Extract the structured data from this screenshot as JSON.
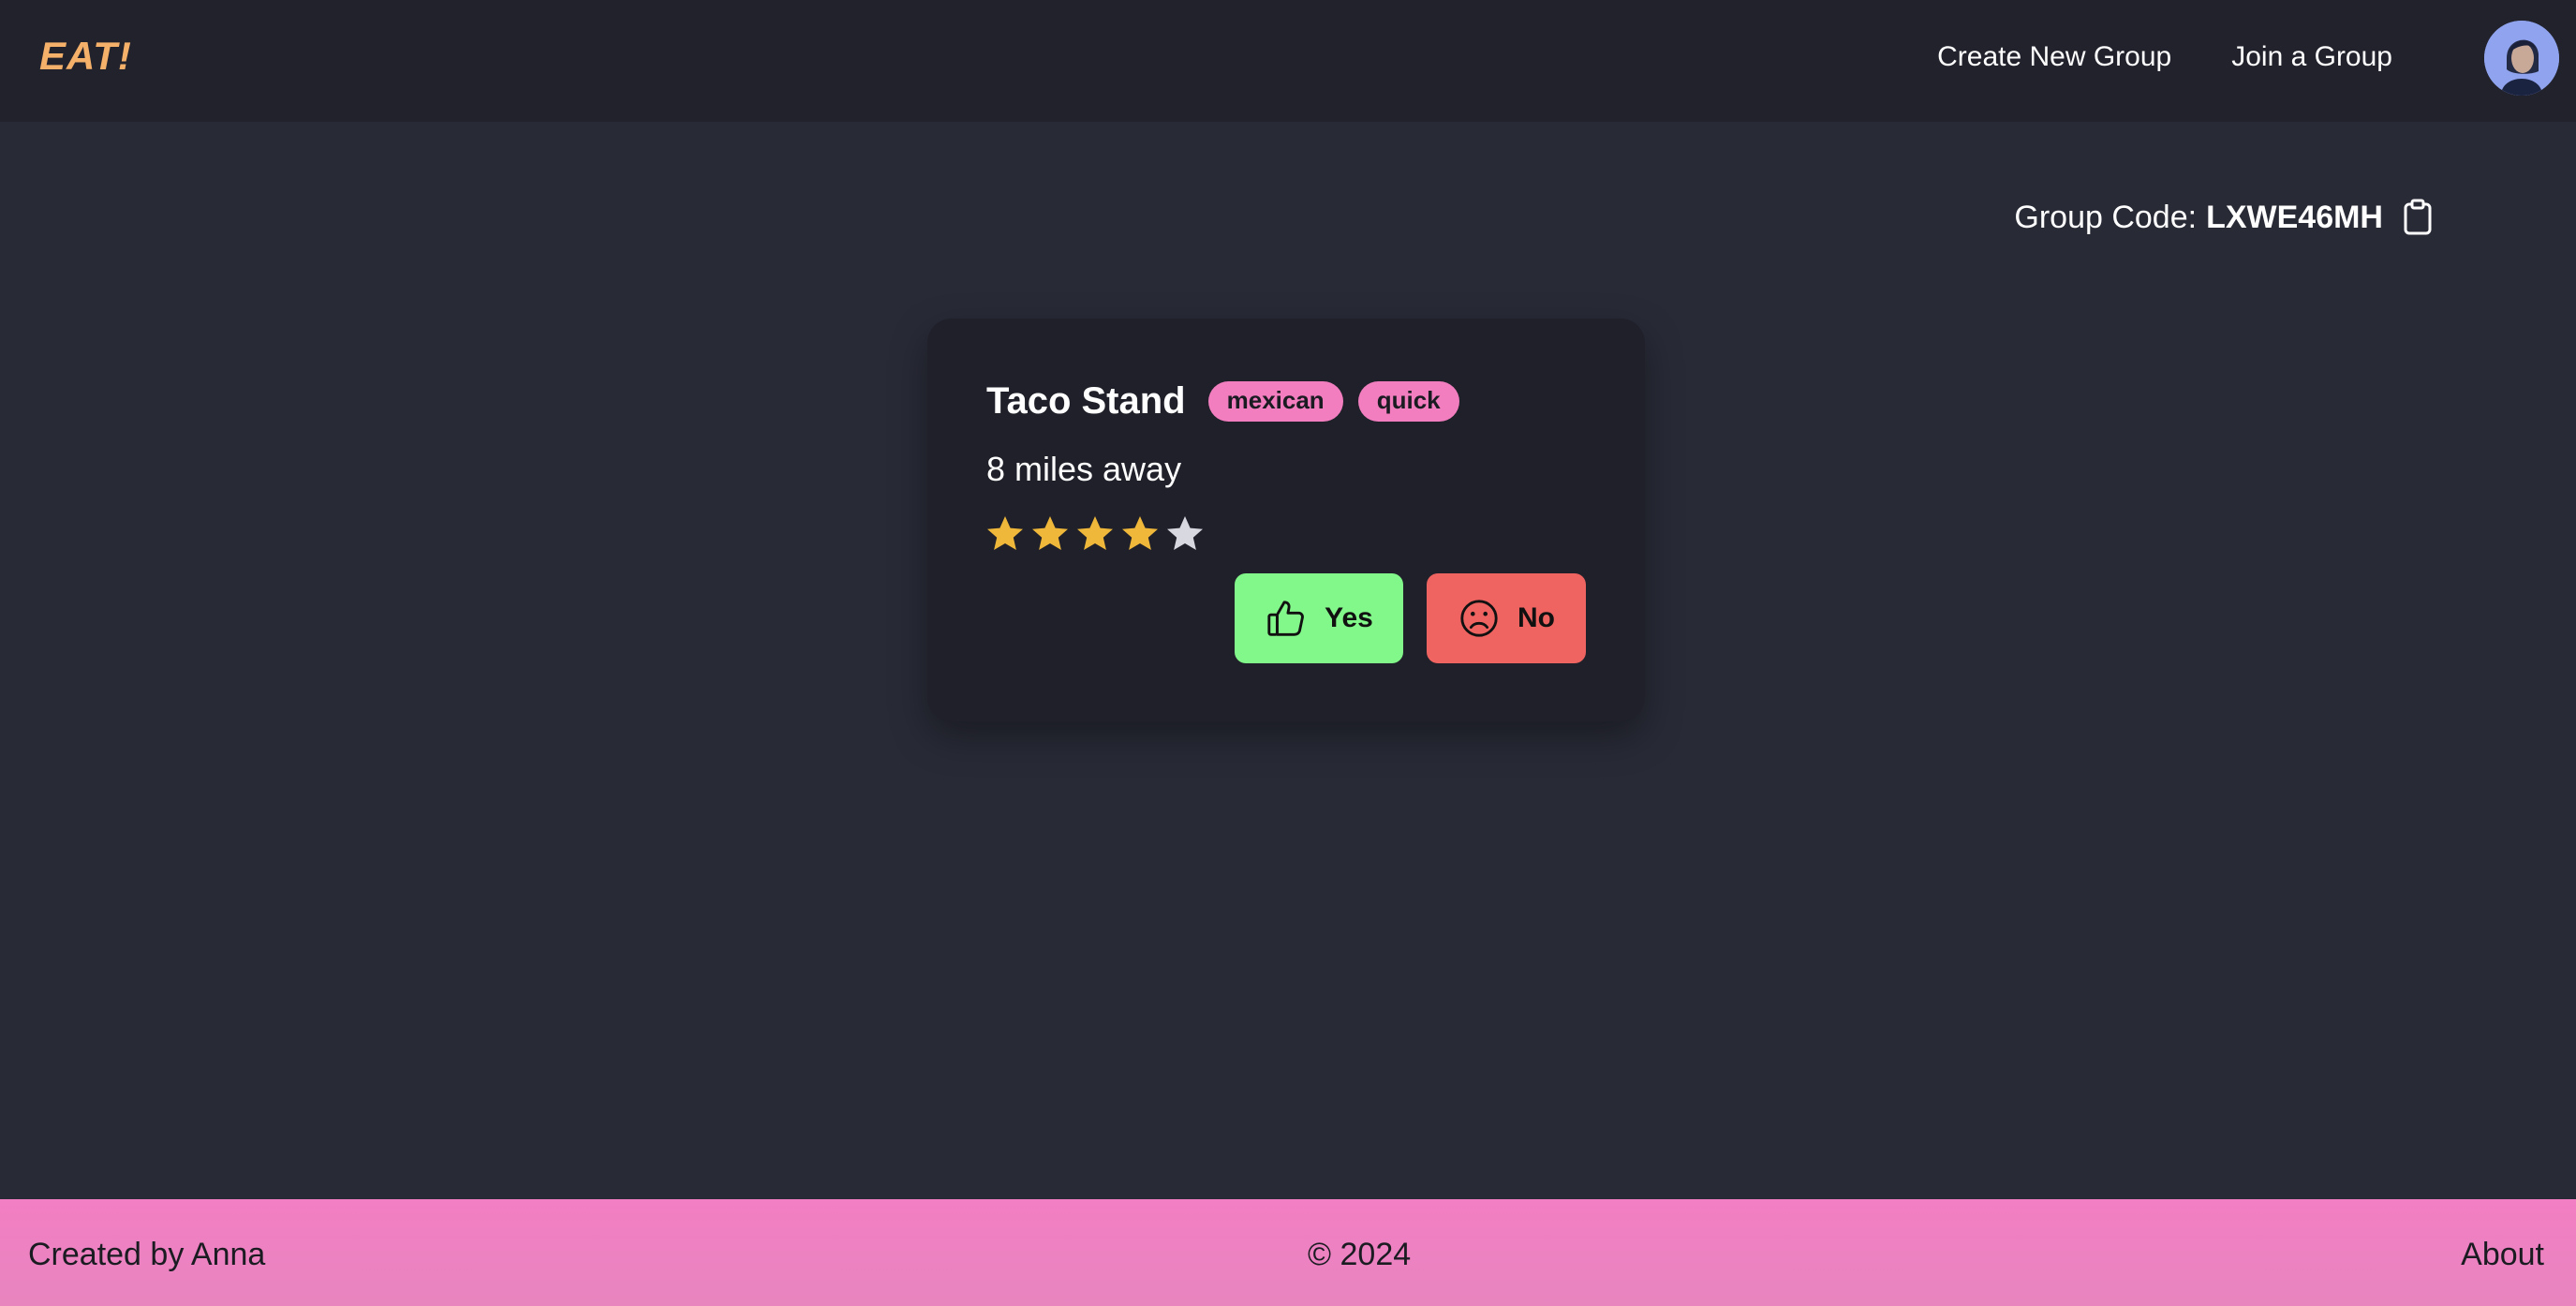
{
  "navbar": {
    "brand": "EAT!",
    "links": [
      "Create New Group",
      "Join a Group"
    ],
    "avatar_icon": "user-avatar"
  },
  "group": {
    "label": "Group Code:",
    "code": "LXWE46MH",
    "copy_icon": "clipboard-icon"
  },
  "card": {
    "name": "Taco Stand",
    "tags": [
      "mexican",
      "quick"
    ],
    "distance": "8 miles away",
    "rating": 4,
    "rating_max": 5,
    "yes_label": "Yes",
    "no_label": "No",
    "yes_icon": "thumbs-up-icon",
    "no_icon": "sad-face-icon"
  },
  "footer": {
    "left": "Created by Anna",
    "center": "© 2024",
    "right": "About"
  },
  "colors": {
    "background": "#282a36",
    "navbar": "#21222c",
    "card": "#1f2029",
    "brand": "#f5b06a",
    "tag": "#f27ec0",
    "yes": "#82f88a",
    "no": "#ef6461",
    "footer": "#f27ec3",
    "star_filled": "#f0b83a",
    "star_empty": "#d8d8e0"
  }
}
